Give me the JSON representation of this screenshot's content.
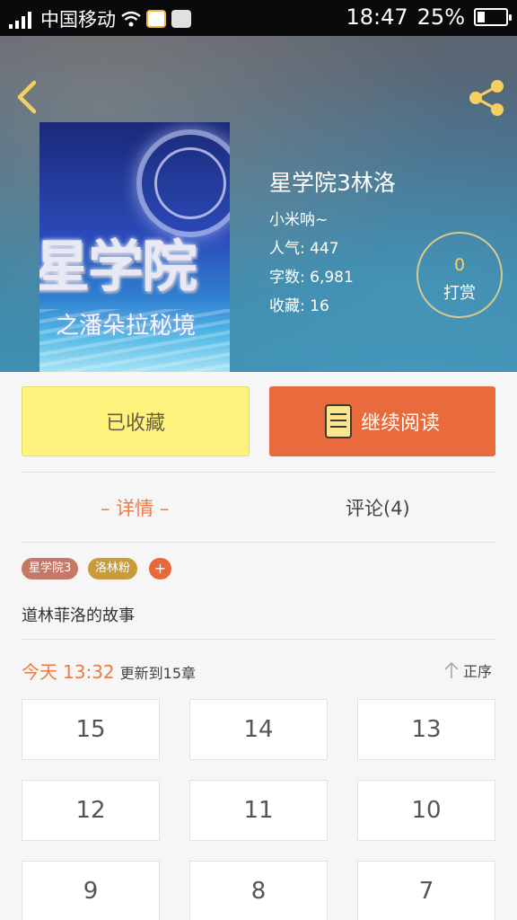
{
  "status_bar": {
    "carrier": "中国移动",
    "time": "18:47",
    "battery": "25%",
    "battery_level": 0.25
  },
  "book": {
    "title": "星学院3林洛",
    "author": "小米呐~",
    "stats": [
      {
        "key": "人气:",
        "value": "447"
      },
      {
        "key": "字数:",
        "value": "6,981"
      },
      {
        "key": "收藏:",
        "value": "16"
      }
    ],
    "cover_text": {
      "main": "星学院",
      "sub": "之潘朵拉秘境"
    }
  },
  "tip": {
    "count": "0",
    "label": "打赏"
  },
  "actions": {
    "favorited_label": "已收藏",
    "continue_label": "继续阅读"
  },
  "tabs": {
    "detail": "– 详情 –",
    "comments": "评论(4)"
  },
  "tags": [
    "星学院3",
    "洛林粉",
    "+"
  ],
  "description": "道林菲洛的故事",
  "update": {
    "day": "今天",
    "time": "13:32",
    "text": "更新到15章"
  },
  "sort_label": "正序",
  "chapters": [
    "15",
    "14",
    "13",
    "12",
    "11",
    "10",
    "9",
    "8",
    "7"
  ],
  "colors": {
    "accent": "#ee7a46",
    "favorite_bg": "#fdf37d",
    "read_bg": "#e96a3c"
  }
}
